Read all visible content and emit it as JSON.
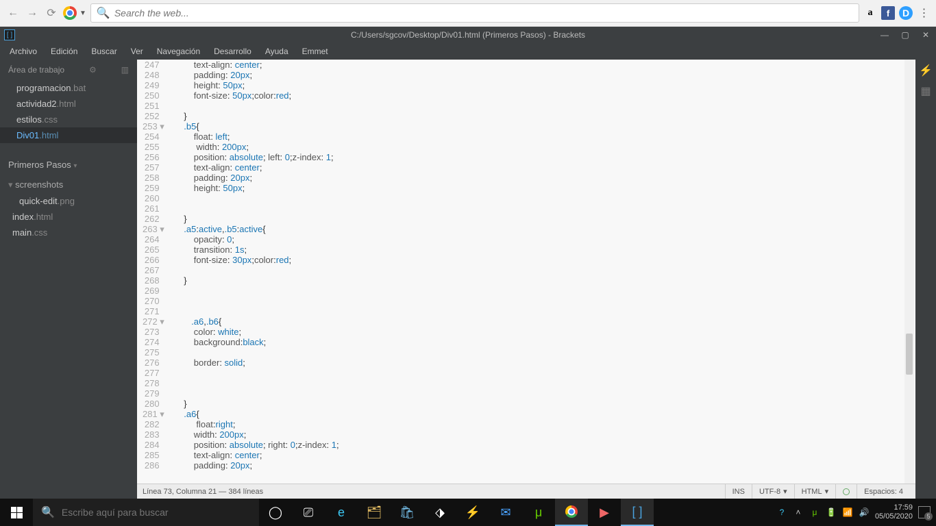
{
  "browser": {
    "search_placeholder": "Search the web..."
  },
  "brackets": {
    "title": "C:/Users/sgcov/Desktop/Div01.html (Primeros Pasos) - Brackets",
    "menu": [
      "Archivo",
      "Edición",
      "Buscar",
      "Ver",
      "Navegación",
      "Desarrollo",
      "Ayuda",
      "Emmet"
    ],
    "workspace_label": "Área de trabajo",
    "working_files": [
      {
        "name": "programacion",
        "ext": ".bat"
      },
      {
        "name": "actividad2",
        "ext": ".html"
      },
      {
        "name": "estilos",
        "ext": ".css"
      },
      {
        "name": "Div01",
        "ext": ".html",
        "active": true
      }
    ],
    "project_name": "Primeros Pasos",
    "project_tree": {
      "folder": "screenshots",
      "folder_files": [
        {
          "name": "quick-edit",
          "ext": ".png"
        }
      ],
      "root_files": [
        {
          "name": "index",
          "ext": ".html"
        },
        {
          "name": "main",
          "ext": ".css"
        }
      ]
    },
    "code_lines": [
      {
        "n": 247,
        "html": "        <span class='c-prop'>text-align</span>: <span class='c-val'>center</span>;"
      },
      {
        "n": 248,
        "html": "        <span class='c-prop'>padding</span>: <span class='c-num'>20px</span>;"
      },
      {
        "n": 249,
        "html": "        <span class='c-prop'>height</span>: <span class='c-num'>50px</span>;"
      },
      {
        "n": 250,
        "html": "        <span class='c-prop'>font-size</span>: <span class='c-num'>50px</span>;<span class='c-prop'>color</span>:<span class='c-val'>red</span>;"
      },
      {
        "n": 251,
        "html": ""
      },
      {
        "n": 252,
        "html": "    }"
      },
      {
        "n": 253,
        "fold": true,
        "html": "    <span class='c-sel'>.b5</span>{"
      },
      {
        "n": 254,
        "html": "        <span class='c-prop'>float</span>: <span class='c-val'>left</span>;"
      },
      {
        "n": 255,
        "html": "         <span class='c-prop'>width</span>: <span class='c-num'>200px</span>;"
      },
      {
        "n": 256,
        "html": "        <span class='c-prop'>position</span>: <span class='c-val'>absolute</span>; <span class='c-prop'>left</span>: <span class='c-num'>0</span>;<span class='c-prop'>z-index</span>: <span class='c-num'>1</span>;"
      },
      {
        "n": 257,
        "html": "        <span class='c-prop'>text-align</span>: <span class='c-val'>center</span>;"
      },
      {
        "n": 258,
        "html": "        <span class='c-prop'>padding</span>: <span class='c-num'>20px</span>;"
      },
      {
        "n": 259,
        "html": "        <span class='c-prop'>height</span>: <span class='c-num'>50px</span>;"
      },
      {
        "n": 260,
        "html": ""
      },
      {
        "n": 261,
        "html": ""
      },
      {
        "n": 262,
        "html": "    }"
      },
      {
        "n": 263,
        "fold": true,
        "html": "    <span class='c-sel'>.a5</span>:<span class='c-val'>active</span>,<span class='c-sel'>.b5</span>:<span class='c-val'>active</span>{"
      },
      {
        "n": 264,
        "html": "        <span class='c-prop'>opacity</span>: <span class='c-num'>0</span>;"
      },
      {
        "n": 265,
        "html": "        <span class='c-prop'>transition</span>: <span class='c-num'>1s</span>;"
      },
      {
        "n": 266,
        "html": "        <span class='c-prop'>font-size</span>: <span class='c-num'>30px</span>;<span class='c-prop'>color</span>:<span class='c-val'>red</span>;"
      },
      {
        "n": 267,
        "html": ""
      },
      {
        "n": 268,
        "html": "    }"
      },
      {
        "n": 269,
        "html": ""
      },
      {
        "n": 270,
        "html": ""
      },
      {
        "n": 271,
        "html": ""
      },
      {
        "n": 272,
        "fold": true,
        "html": "       <span class='c-sel'>.a6</span>,<span class='c-sel'>.b6</span>{"
      },
      {
        "n": 273,
        "html": "        <span class='c-prop'>color</span>: <span class='c-val'>white</span>;"
      },
      {
        "n": 274,
        "html": "        <span class='c-prop'>background</span>:<span class='c-val'>black</span>;"
      },
      {
        "n": 275,
        "html": ""
      },
      {
        "n": 276,
        "html": "        <span class='c-prop'>border</span>: <span class='c-val'>solid</span>;"
      },
      {
        "n": 277,
        "html": ""
      },
      {
        "n": 278,
        "html": ""
      },
      {
        "n": 279,
        "html": ""
      },
      {
        "n": 280,
        "html": "    }"
      },
      {
        "n": 281,
        "fold": true,
        "html": "    <span class='c-sel'>.a6</span>{"
      },
      {
        "n": 282,
        "html": "         <span class='c-prop'>float</span>:<span class='c-val'>right</span>;"
      },
      {
        "n": 283,
        "html": "        <span class='c-prop'>width</span>: <span class='c-num'>200px</span>;"
      },
      {
        "n": 284,
        "html": "        <span class='c-prop'>position</span>: <span class='c-val'>absolute</span>; <span class='c-prop'>right</span>: <span class='c-num'>0</span>;<span class='c-prop'>z-index</span>: <span class='c-num'>1</span>;"
      },
      {
        "n": 285,
        "html": "        <span class='c-prop'>text-align</span>: <span class='c-val'>center</span>;"
      },
      {
        "n": 286,
        "html": "        <span class='c-prop'>padding</span>: <span class='c-num'>20px</span>;"
      }
    ],
    "status": {
      "cursor": "Línea 73, Columna 21 — 384 líneas",
      "ins": "INS",
      "encoding": "UTF-8",
      "lang": "HTML",
      "spaces": "Espacios: 4"
    }
  },
  "taskbar": {
    "search_placeholder": "Escribe aquí para buscar",
    "time": "17:59",
    "date": "05/05/2020",
    "notif_count": "5"
  }
}
